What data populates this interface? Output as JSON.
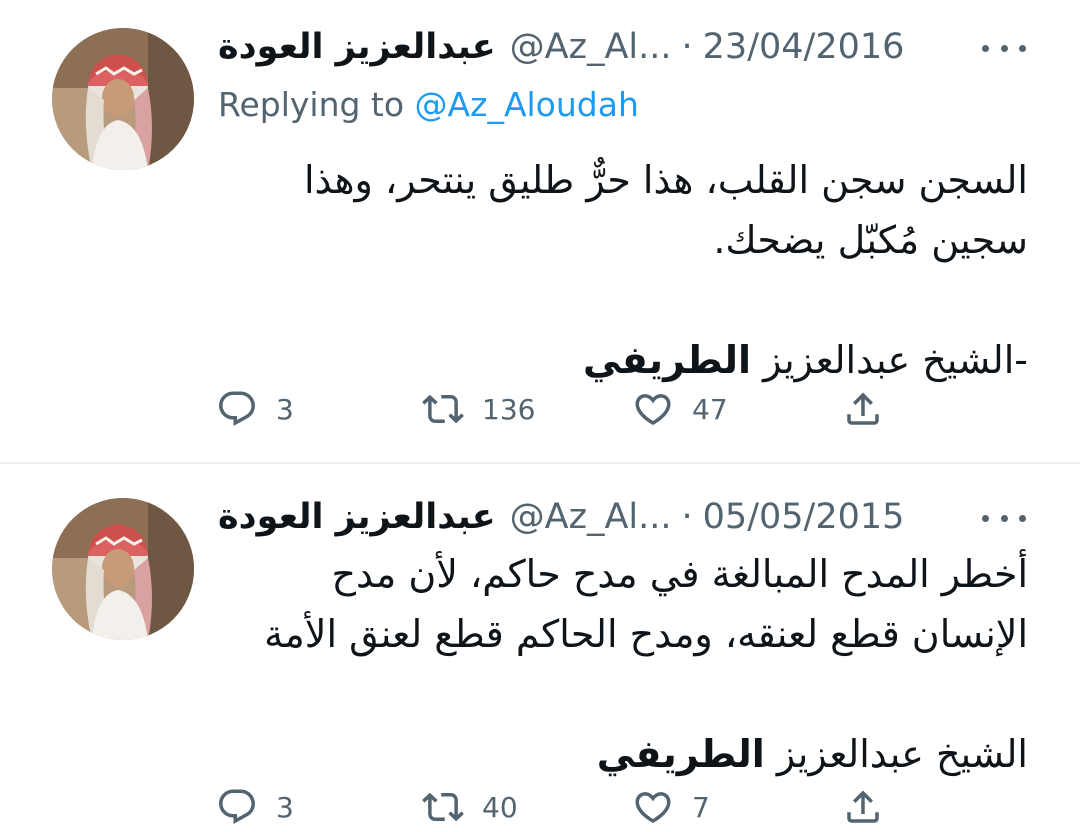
{
  "tweets": [
    {
      "author_name": "عبدالعزيز العودة",
      "handle": "@Az_Al...",
      "separator": "·",
      "date": "23/04/2016",
      "replying_prefix": "Replying to ",
      "replying_to": "@Az_Aloudah",
      "body_lines": [
        "السجن سجن القلب، هذا حرٌّ طليق ينتحر، وهذا",
        "سجين مُكبّل يضحك."
      ],
      "signature_prefix": "-الشيخ عبدالعزيز ",
      "signature_bold": "الطريفي",
      "actions": {
        "reply_icon": "reply-icon",
        "reply_count": "3",
        "retweet_icon": "retweet-icon",
        "retweet_count": "136",
        "like_icon": "heart-icon",
        "like_count": "47",
        "share_icon": "share-icon"
      }
    },
    {
      "author_name": "عبدالعزيز العودة",
      "handle": "@Az_Al...",
      "separator": "·",
      "date": "05/05/2015",
      "body_lines": [
        "أخطر المدح المبالغة في مدح حاكم، لأن مدح",
        "الإنسان قطع لعنقه، ومدح الحاكم قطع لعنق الأمة"
      ],
      "signature_prefix": "الشيخ عبدالعزيز ",
      "signature_bold": "الطريفي",
      "actions": {
        "reply_icon": "reply-icon",
        "reply_count": "3",
        "retweet_icon": "retweet-icon",
        "retweet_count": "40",
        "like_icon": "heart-icon",
        "like_count": "7",
        "share_icon": "share-icon"
      }
    }
  ],
  "colors": {
    "text": "#0f1419",
    "secondary": "#536471",
    "link": "#1d9bf0",
    "divider": "#eff3f4"
  }
}
